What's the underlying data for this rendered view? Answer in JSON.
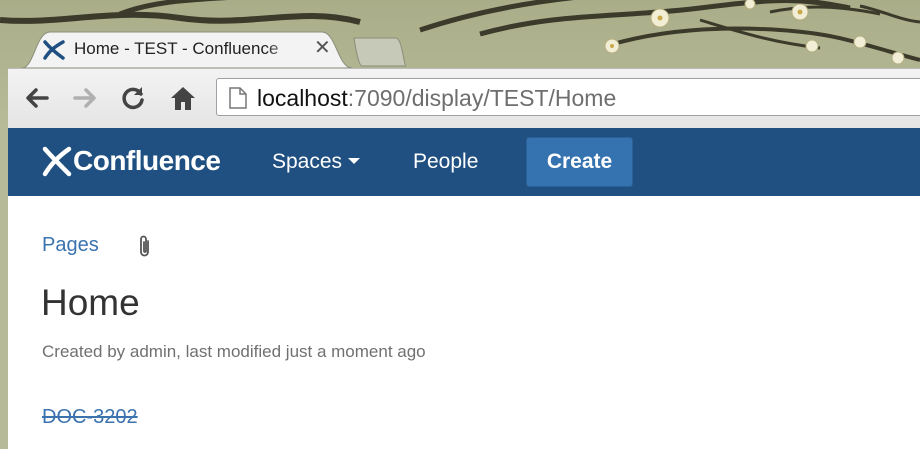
{
  "browser": {
    "tab": {
      "title": "Home - TEST - Confluence",
      "close_glyph": "✕",
      "icon": "confluence-logo-icon"
    },
    "url": {
      "host": "localhost",
      "rest": ":7090/display/TEST/Home"
    },
    "nav_icons": [
      "back-arrow-icon",
      "forward-arrow-icon",
      "reload-icon",
      "home-icon"
    ]
  },
  "header": {
    "logo_text": "Confluence",
    "nav": {
      "spaces": "Spaces",
      "people": "People"
    },
    "create_label": "Create",
    "colors": {
      "header_bg": "#205081",
      "create_bg": "#3572b0"
    }
  },
  "page": {
    "breadcrumb": "Pages",
    "title": "Home",
    "meta": "Created by admin, last modified just a moment ago",
    "jira_link": "DOC-3202"
  }
}
